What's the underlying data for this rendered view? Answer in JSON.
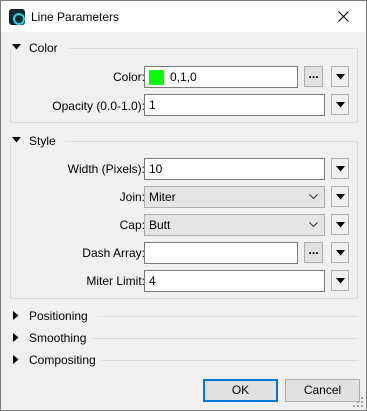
{
  "window": {
    "title": "Line Parameters",
    "icon": "app-icon",
    "close_icon": "close-icon"
  },
  "sections": {
    "color": {
      "header": "Color",
      "expanded": true,
      "color_label": "Color:",
      "color_value": "0,1,0",
      "color_swatch": "#00ff00",
      "ellipsis_label": "...",
      "opacity_label": "Opacity (0.0-1.0):",
      "opacity_value": "1"
    },
    "style": {
      "header": "Style",
      "expanded": true,
      "width_label": "Width (Pixels):",
      "width_value": "10",
      "join_label": "Join:",
      "join_value": "Miter",
      "cap_label": "Cap:",
      "cap_value": "Butt",
      "dash_label": "Dash Array:",
      "dash_value": "",
      "ellipsis_label": "...",
      "miter_label": "Miter Limit:",
      "miter_value": "4"
    },
    "positioning": {
      "header": "Positioning",
      "expanded": false
    },
    "smoothing": {
      "header": "Smoothing",
      "expanded": false
    },
    "compositing": {
      "header": "Compositing",
      "expanded": false
    }
  },
  "buttons": {
    "ok": "OK",
    "cancel": "Cancel"
  },
  "colors": {
    "accent": "#0078d7",
    "swatch": "#00ff00"
  }
}
